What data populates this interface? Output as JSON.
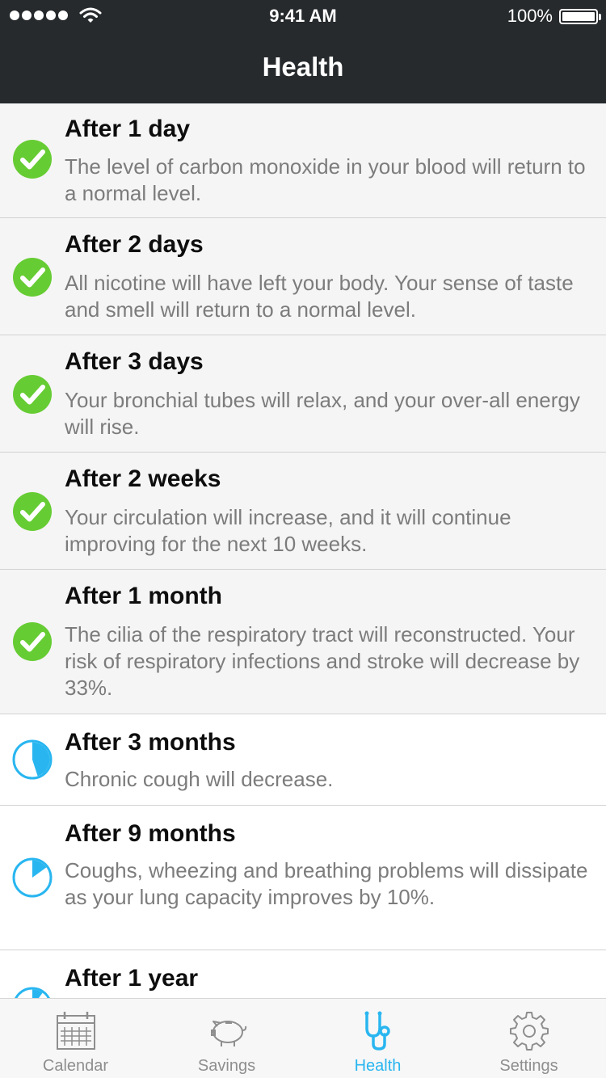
{
  "status_bar": {
    "time": "9:41 AM",
    "battery": "100%"
  },
  "header": {
    "title": "Health"
  },
  "colors": {
    "done": "#66cc33",
    "progress": "#29b6f0",
    "header_bg": "#262a2c"
  },
  "milestones": [
    {
      "title": "After 1 day",
      "desc": "The level of carbon monoxide in your blood will return to a normal level.",
      "status": "done",
      "icon": "check-circle-icon"
    },
    {
      "title": "After 2 days",
      "desc": "All nicotine will have left your body. Your sense of taste and smell will return to a normal level.",
      "status": "done",
      "icon": "check-circle-icon"
    },
    {
      "title": "After 3 days",
      "desc": "Your bronchial tubes will relax, and your over-all energy will rise.",
      "status": "done",
      "icon": "check-circle-icon"
    },
    {
      "title": "After 2 weeks",
      "desc": "Your circulation will increase, and it will continue improving for the next 10 weeks.",
      "status": "done",
      "icon": "check-circle-icon"
    },
    {
      "title": "After 1 month",
      "desc": "The cilia of the respiratory tract will reconstructed. Your risk of respiratory infections and stroke will decrease by 33%.",
      "status": "done",
      "icon": "check-circle-icon"
    },
    {
      "title": "After 3 months",
      "desc": "Chronic cough will decrease.",
      "status": "in-progress",
      "progress": 0.45,
      "icon": "progress-pie-icon"
    },
    {
      "title": "After 9 months",
      "desc": "Coughs, wheezing and breathing problems will dissipate as your lung capacity improves by 10%.",
      "status": "in-progress",
      "progress": 0.15,
      "icon": "progress-pie-icon"
    },
    {
      "title": "After 1 year",
      "desc": "",
      "status": "in-progress",
      "progress": 0.1,
      "icon": "progress-pie-icon"
    }
  ],
  "tabs": [
    {
      "label": "Calendar",
      "icon": "calendar-icon",
      "active": false
    },
    {
      "label": "Savings",
      "icon": "piggy-bank-icon",
      "active": false
    },
    {
      "label": "Health",
      "icon": "stethoscope-icon",
      "active": true
    },
    {
      "label": "Settings",
      "icon": "gear-icon",
      "active": false
    }
  ]
}
